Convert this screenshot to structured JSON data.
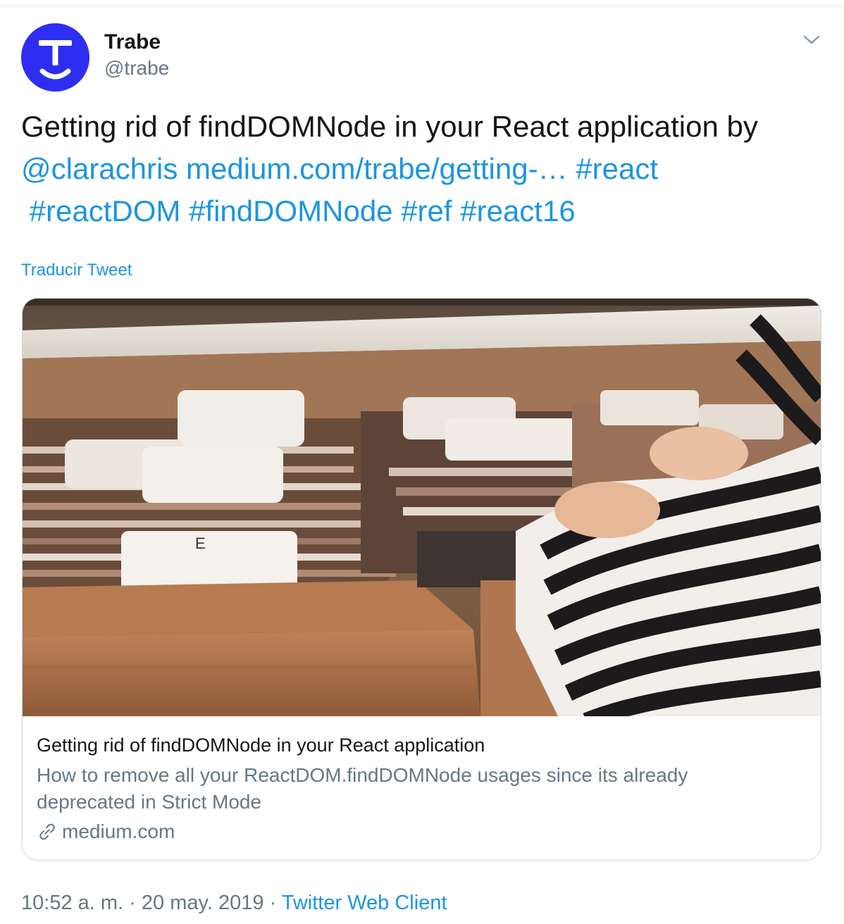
{
  "account": {
    "name": "Trabe",
    "handle": "@trabe",
    "avatar_color": "#2d2ef2"
  },
  "tweet": {
    "text_plain": "Getting rid of findDOMNode in your React application by",
    "mention": "@clarachris",
    "url": "medium.com/trabe/getting-…",
    "hashtags": [
      "#react",
      "#reactDOM",
      "#findDOMNode",
      "#ref",
      "#react16"
    ]
  },
  "translate_label": "Traducir Tweet",
  "card": {
    "title": "Getting rid of findDOMNode in your React application",
    "description": "How to remove all your ReactDOM.findDOMNode usages since its already deprecated in Strict Mode",
    "domain": "medium.com",
    "image_icon": "record-crates-photo"
  },
  "meta": {
    "time": "10:52 a. m.",
    "separator": "·",
    "date": "20 may. 2019",
    "client": "Twitter Web Client"
  },
  "colors": {
    "link": "#1b95e0",
    "secondary_text": "#657786",
    "border": "#ccd6dd"
  },
  "icons": {
    "caret": "chevron-down-icon",
    "link": "link-icon"
  }
}
